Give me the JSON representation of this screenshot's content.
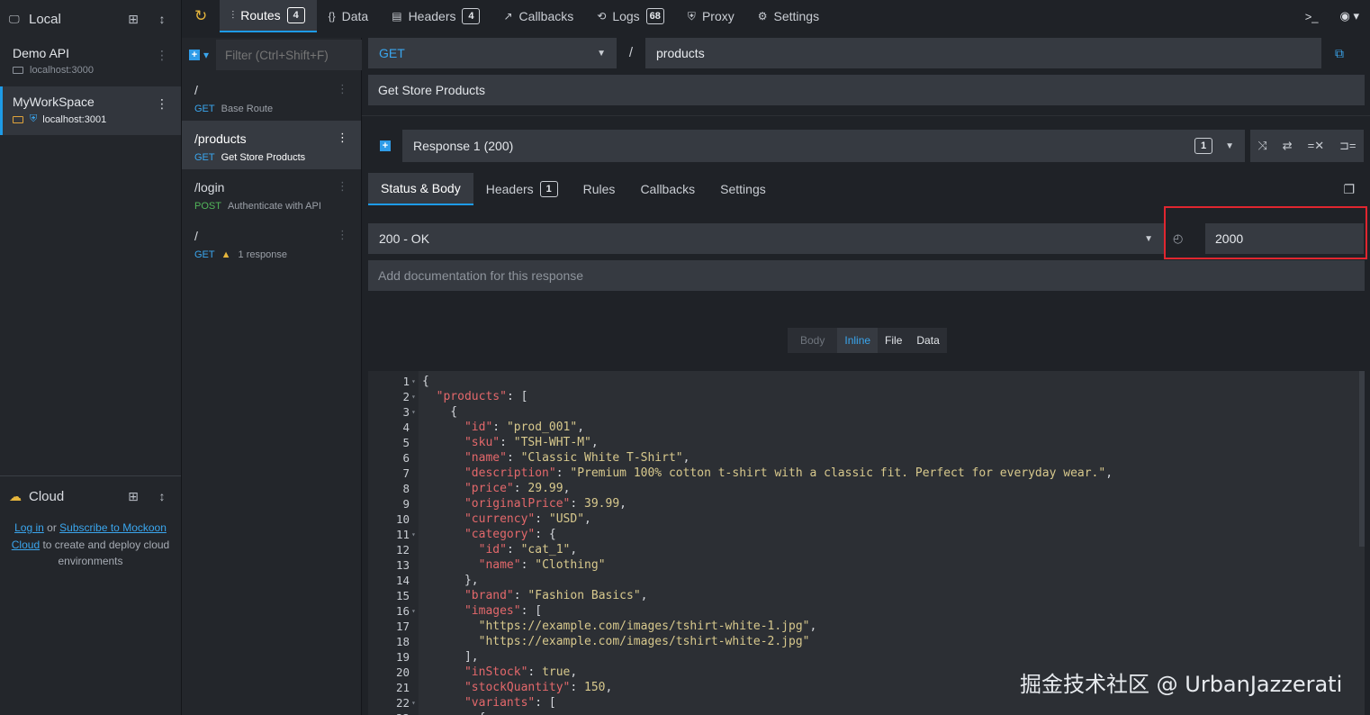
{
  "env_panel": {
    "local_title": "Local",
    "environments": [
      {
        "name": "Demo API",
        "host": "localhost:3000"
      },
      {
        "name": "MyWorkSpace",
        "host": "localhost:3001"
      }
    ],
    "cloud_title": "Cloud",
    "cloud_login": "Log in",
    "cloud_or": " or ",
    "cloud_subscribe": "Subscribe to Mockoon Cloud",
    "cloud_rest": " to create and deploy cloud environments"
  },
  "topnav": {
    "tabs": [
      {
        "label": "Routes",
        "badge": "4"
      },
      {
        "label": "Data"
      },
      {
        "label": "Headers",
        "badge": "4"
      },
      {
        "label": "Callbacks"
      },
      {
        "label": "Logs",
        "badge": "68"
      },
      {
        "label": "Proxy"
      },
      {
        "label": "Settings"
      }
    ]
  },
  "routes_panel": {
    "filter_placeholder": "Filter (Ctrl+Shift+F)",
    "routes": [
      {
        "path": "/",
        "method": "GET",
        "desc": "Base Route"
      },
      {
        "path": "/products",
        "method": "GET",
        "desc": "Get Store Products"
      },
      {
        "path": "/login",
        "method": "POST",
        "desc": "Authenticate with API"
      },
      {
        "path": "/",
        "method": "GET",
        "desc": "1 response"
      }
    ]
  },
  "route_editor": {
    "method": "GET",
    "slash": "/",
    "path": "products",
    "documentation": "Get Store Products",
    "response_label": "Response 1 (200)",
    "response_count": "1",
    "subtabs": [
      {
        "label": "Status & Body"
      },
      {
        "label": "Headers",
        "badge": "1"
      },
      {
        "label": "Rules"
      },
      {
        "label": "Callbacks"
      },
      {
        "label": "Settings"
      }
    ],
    "status": "200 - OK",
    "latency": "2000",
    "response_doc_placeholder": "Add documentation for this response",
    "body_tabs": {
      "label": "Body",
      "options": [
        "Inline",
        "File",
        "Data"
      ]
    }
  },
  "watermark": "掘金技术社区 @ UrbanJazzerati"
}
